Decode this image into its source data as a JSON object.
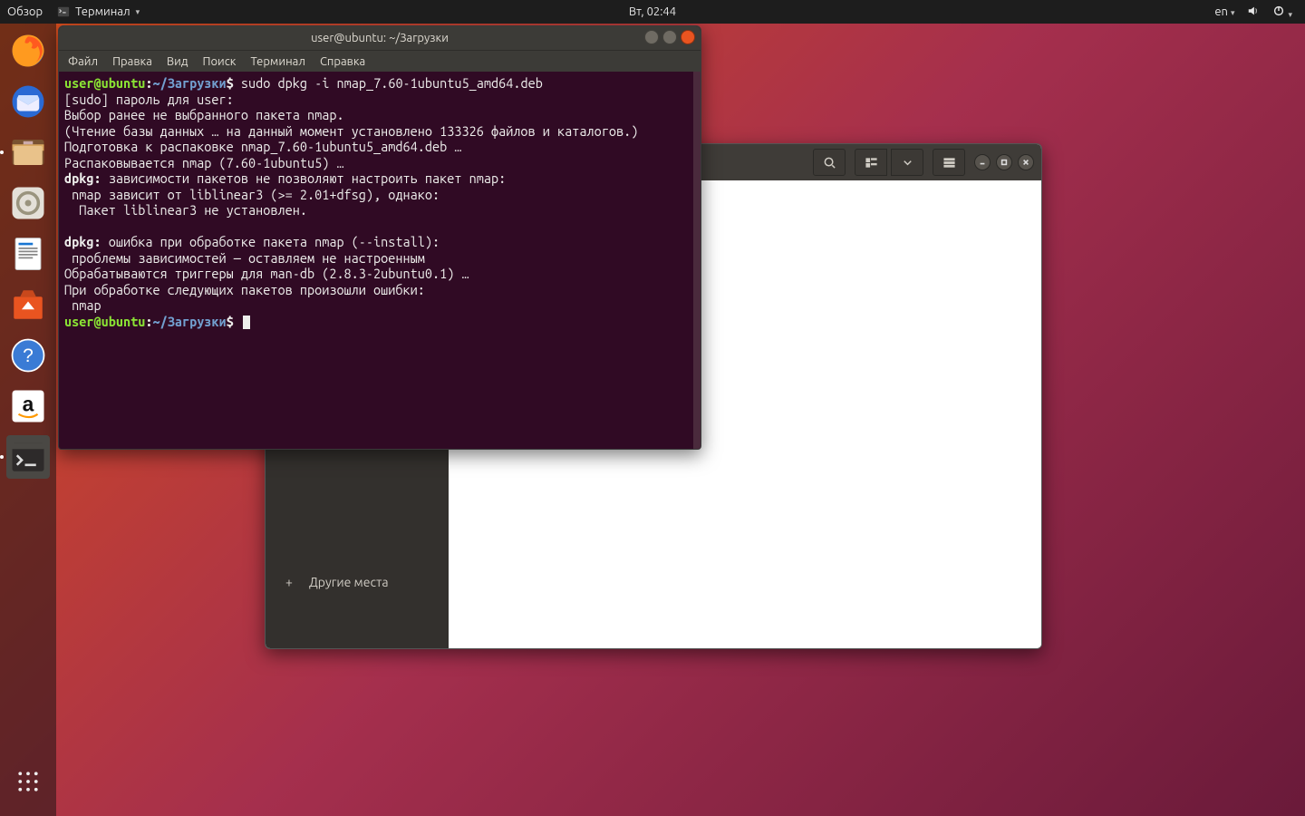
{
  "top_panel": {
    "activities": "Обзор",
    "app_name": "Терминал",
    "clock": "Вт, 02:44",
    "lang": "en"
  },
  "dock": {
    "items": [
      "firefox",
      "thunderbird",
      "files",
      "rhythmbox",
      "writer",
      "software",
      "help",
      "amazon",
      "terminal"
    ]
  },
  "terminal": {
    "title": "user@ubuntu: ~/Загрузки",
    "menus": [
      "Файл",
      "Правка",
      "Вид",
      "Поиск",
      "Терминал",
      "Справка"
    ],
    "prompt": {
      "user": "user",
      "at": "@",
      "host": "ubuntu",
      "colon": ":",
      "path": "~/Загрузки",
      "dollar": "$"
    },
    "cmd1": "sudo dpkg -i nmap_7.60-1ubuntu5_amd64.deb",
    "lines": [
      "[sudo] пароль для user:",
      "Выбор ранее не выбранного пакета nmap.",
      "(Чтение базы данных … на данный момент установлено 133326 файлов и каталогов.)",
      "Подготовка к распаковке nmap_7.60-1ubuntu5_amd64.deb …",
      "Распаковывается nmap (7.60-1ubuntu5) …"
    ],
    "dpkg1_label": "dpkg:",
    "dpkg1_rest": " зависимости пакетов не позволяют настроить пакет nmap:",
    "dep_lines": [
      " nmap зависит от liblinear3 (>= 2.01+dfsg), однако:",
      "  Пакет liblinear3 не установлен.",
      ""
    ],
    "dpkg2_label": "dpkg:",
    "dpkg2_rest": " ошибка при обработке пакета nmap (--install):",
    "tail_lines": [
      " проблемы зависимостей — оставляем не настроенным",
      "Обрабатываются триггеры для man-db (2.8.3-2ubuntu0.1) …",
      "При обработке следующих пакетов произошли ошибки:",
      " nmap"
    ]
  },
  "files": {
    "sidebar_other": "Другие места"
  }
}
